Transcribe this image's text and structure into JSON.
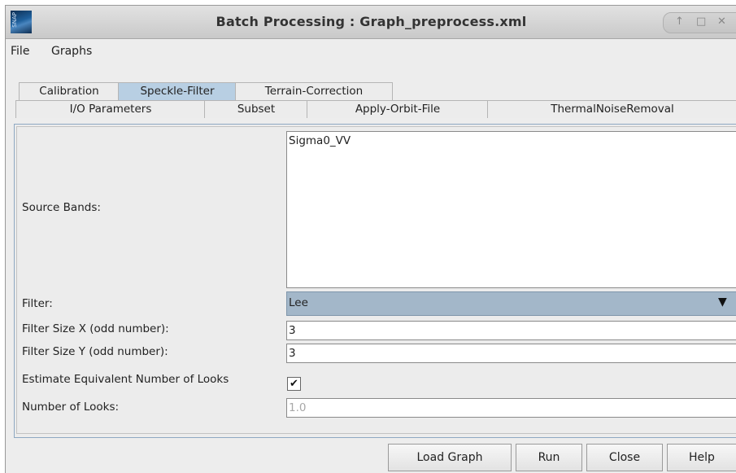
{
  "window": {
    "title": "Batch Processing : Graph_preprocess.xml",
    "logo_text": "SNAP",
    "controls": [
      "↑",
      "□",
      "✕"
    ]
  },
  "menu": [
    "File",
    "Graphs"
  ],
  "tabs_row1": [
    {
      "label": "Calibration",
      "active": false
    },
    {
      "label": "Speckle-Filter",
      "active": true
    },
    {
      "label": "Terrain-Correction",
      "active": false
    }
  ],
  "tabs_row2": [
    {
      "label": "I/O Parameters"
    },
    {
      "label": "Subset"
    },
    {
      "label": "Apply-Orbit-File"
    },
    {
      "label": "ThermalNoiseRemoval"
    }
  ],
  "form": {
    "source_bands_label": "Source Bands:",
    "source_bands": [
      "Sigma0_VV"
    ],
    "filter_label": "Filter:",
    "filter_value": "Lee",
    "filter_size_x_label": "Filter Size X (odd number):",
    "filter_size_x": "3",
    "filter_size_y_label": "Filter Size Y (odd number):",
    "filter_size_y": "3",
    "estimate_enl_label": "Estimate Equivalent Number of Looks",
    "estimate_enl_checked": true,
    "estimate_enl_mark": "✔",
    "num_looks_label": "Number of Looks:",
    "num_looks": "1.0"
  },
  "buttons": {
    "load_graph": "Load Graph",
    "run": "Run",
    "close": "Close",
    "help": "Help"
  }
}
